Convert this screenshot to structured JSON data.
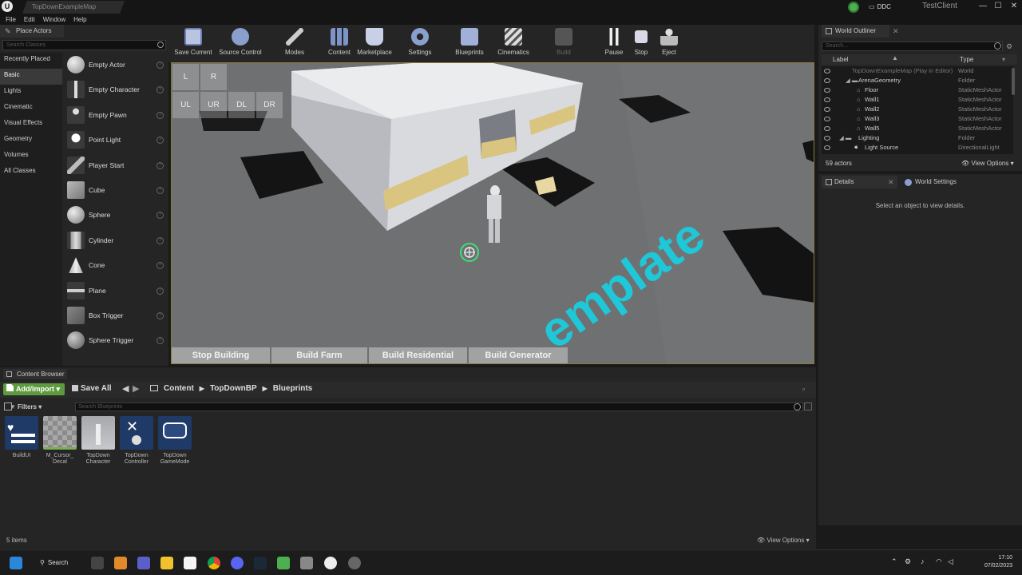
{
  "titlebar": {
    "doc_tab": "TopDownExampleMap",
    "ddc": "DDC",
    "test_client": "TestClient",
    "minimize": "—",
    "maximize": "☐",
    "close": "✕"
  },
  "menu": [
    "File",
    "Edit",
    "Window",
    "Help"
  ],
  "place_actors": {
    "tab_title": "Place Actors",
    "search_placeholder": "Search Classes",
    "categories": [
      "Recently Placed",
      "Basic",
      "Lights",
      "Cinematic",
      "Visual Effects",
      "Geometry",
      "Volumes",
      "All Classes"
    ],
    "selected_category": "Basic",
    "actors": [
      "Empty Actor",
      "Empty Character",
      "Empty Pawn",
      "Point Light",
      "Player Start",
      "Cube",
      "Sphere",
      "Cylinder",
      "Cone",
      "Plane",
      "Box Trigger",
      "Sphere Trigger"
    ]
  },
  "toolbar": {
    "save_current": "Save Current",
    "source_control": "Source Control",
    "modes": "Modes",
    "content": "Content",
    "marketplace": "Marketplace",
    "settings": "Settings",
    "blueprints": "Blueprints",
    "cinematics": "Cinematics",
    "build": "Build",
    "pause": "Pause",
    "stop": "Stop",
    "eject": "Eject"
  },
  "viewport": {
    "view_buttons": [
      "L",
      "R",
      "UL",
      "UR",
      "DL",
      "DR"
    ],
    "build_buttons": [
      "Stop Building",
      "Build Farm",
      "Build Residential",
      "Build Generator"
    ],
    "floor_text": "emplate"
  },
  "outliner": {
    "tab_title": "World Outliner",
    "search_placeholder": "Search...",
    "col_label": "Label",
    "col_type": "Type",
    "rows": [
      {
        "label": "TopDownExampleMap (Play in Editor)",
        "type": "World"
      },
      {
        "label": "ArenaGeometry",
        "type": "Folder"
      },
      {
        "label": "Floor",
        "type": "StaticMeshActor"
      },
      {
        "label": "Wall1",
        "type": "StaticMeshActor"
      },
      {
        "label": "Wall2",
        "type": "StaticMeshActor"
      },
      {
        "label": "Wall3",
        "type": "StaticMeshActor"
      },
      {
        "label": "Wall5",
        "type": "StaticMeshActor"
      },
      {
        "label": "Lighting",
        "type": "Folder"
      },
      {
        "label": "Light Source",
        "type": "DirectionalLight"
      }
    ],
    "actor_count": "59 actors",
    "view_options": "View Options"
  },
  "details": {
    "tab_title": "Details",
    "world_settings_tab": "World Settings",
    "message": "Select an object to view details."
  },
  "content_browser": {
    "tab_title": "Content Browser",
    "add_import": "Add/Import",
    "save_all": "Save All",
    "path": [
      "Content",
      "TopDownBP",
      "Blueprints"
    ],
    "filters": "Filters",
    "search_placeholder": "Search Blueprints",
    "assets": [
      {
        "name": "BuildUI"
      },
      {
        "name": "M_Cursor_ Decal"
      },
      {
        "name": "TopDown Character"
      },
      {
        "name": "TopDown Controller"
      },
      {
        "name": "TopDown GameMode"
      }
    ],
    "item_count": "5 items",
    "view_options": "View Options"
  },
  "taskbar": {
    "search": "Search",
    "time": "17:10",
    "date": "07/02/2023"
  },
  "colors": {
    "accent_green": "#5e9a3e",
    "floor_text_cyan": "#1ec8d8",
    "building_stripe": "#d9c57f"
  }
}
